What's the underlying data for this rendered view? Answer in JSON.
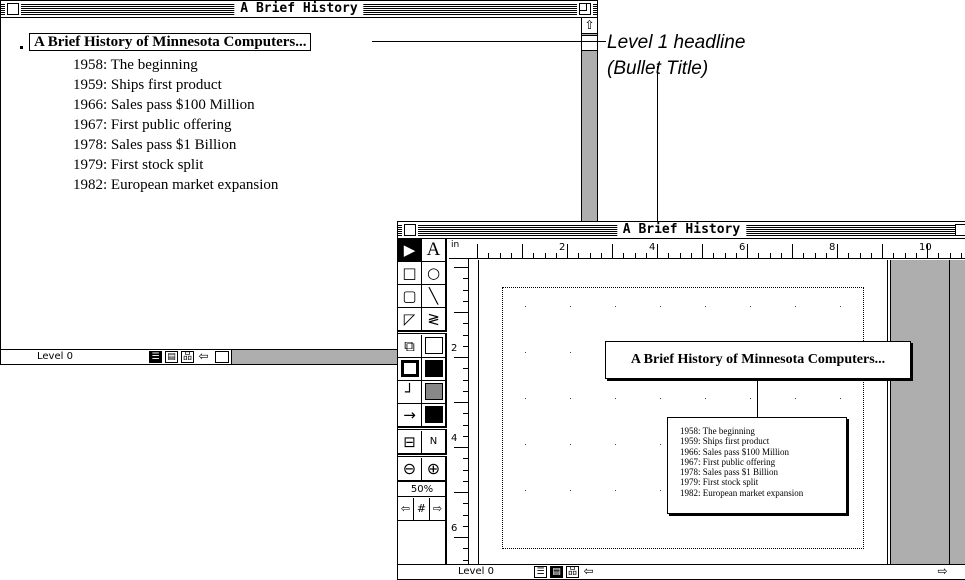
{
  "outline_window": {
    "title": "A Brief History",
    "headline": "A Brief History of Minnesota Computers...",
    "items": [
      "1958:  The beginning",
      "1959:  Ships first product",
      "1966:  Sales pass $100 Million",
      "1967:  First public offering",
      "1978:  Sales pass $1 Billion",
      "1979:  First stock split",
      "1982:  European market expansion"
    ],
    "status_level": "Level 0",
    "scroll_up_icon": "up-arrow-icon"
  },
  "callout": {
    "line1": "Level 1 headline",
    "line2": "(Bullet Title)"
  },
  "chart_window": {
    "title": "A Brief History",
    "ruler_unit": "in",
    "ruler_top_numbers": [
      "2",
      "4",
      "6",
      "8",
      "10"
    ],
    "ruler_left_numbers": [
      "2",
      "4",
      "6"
    ],
    "zoom_percent": "50%",
    "headline": "A Brief History of Minnesota Computers...",
    "items": [
      "1958:  The beginning",
      "1959:  Ships first product",
      "1966:  Sales pass $100 Million",
      "1967:  First public offering",
      "1978:  Sales pass $1 Billion",
      "1979:  First stock split",
      "1982:  European market expansion"
    ],
    "status_level": "Level 0",
    "tools": {
      "arrow": "▶",
      "text": "A",
      "line_tag": "N"
    }
  }
}
